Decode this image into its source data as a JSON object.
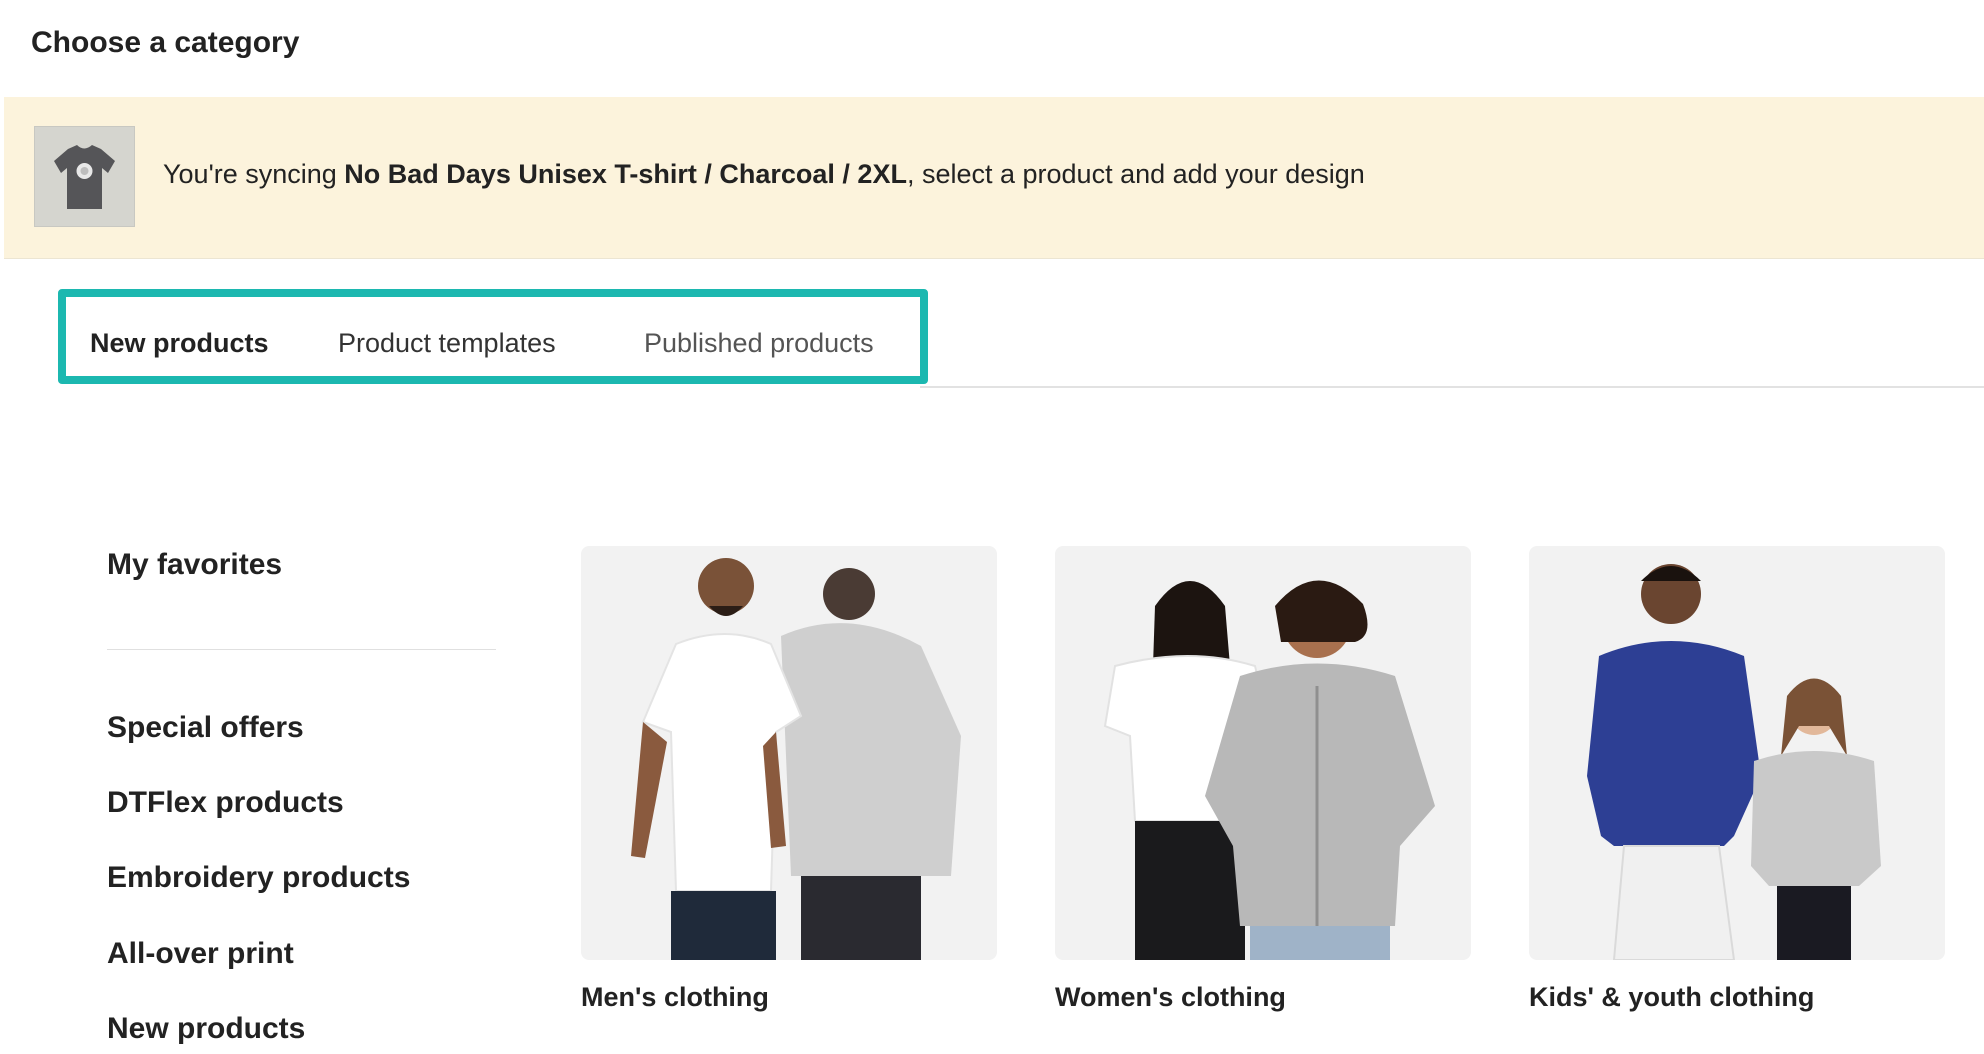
{
  "page": {
    "title": "Choose a category"
  },
  "sync_banner": {
    "prefix": "You're syncing ",
    "product": "No Bad Days Unisex T-shirt / Charcoal / 2XL",
    "suffix": ", select a product and add your design",
    "thumb_icon": "t-shirt-thumbnail",
    "background_color": "#fcf3dc"
  },
  "tabs": {
    "highlight_color": "#1cb8b0",
    "items": [
      {
        "label": "New products",
        "active": true
      },
      {
        "label": "Product templates",
        "active": false
      },
      {
        "label": "Published products",
        "active": false
      }
    ]
  },
  "sidebar": {
    "favorites": "My favorites",
    "items": [
      {
        "label": "Special offers"
      },
      {
        "label": "DTFlex products"
      },
      {
        "label": "Embroidery products"
      },
      {
        "label": "All-over print"
      },
      {
        "label": "New products"
      }
    ]
  },
  "categories": [
    {
      "label": "Men's clothing",
      "image": "men-clothing-photo"
    },
    {
      "label": "Women's clothing",
      "image": "women-clothing-photo"
    },
    {
      "label": "Kids' & youth clothing",
      "image": "kids-clothing-photo"
    }
  ]
}
